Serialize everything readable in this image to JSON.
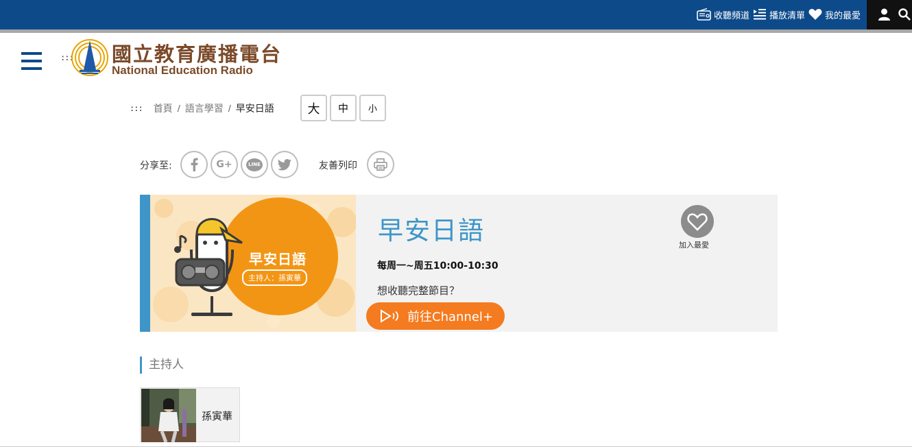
{
  "topbar": {
    "links": [
      {
        "icon": "radio-icon",
        "label": "收聽頻道"
      },
      {
        "icon": "playlist-icon",
        "label": "播放清單"
      },
      {
        "icon": "heart-icon",
        "label": "我的最愛"
      }
    ],
    "user_icon": "user-icon",
    "search_icon": "search-icon"
  },
  "header": {
    "menu_icon": "hamburger-menu-icon",
    "logo_dots": ":::",
    "logo_cn": "國立教育廣播電台",
    "logo_en": "National Education Radio"
  },
  "breadcrumb": {
    "dots": ":::",
    "items": [
      "首頁",
      "語言學習",
      "早安日語"
    ],
    "separator": "/"
  },
  "font_size": {
    "buttons": [
      "大",
      "中",
      "小"
    ]
  },
  "share": {
    "label": "分享至:",
    "buttons": [
      "facebook-icon",
      "google-plus-icon",
      "line-icon",
      "twitter-icon"
    ],
    "gplus_text": "G+",
    "line_text": "LINE",
    "print_label": "友善列印",
    "print_icon": "printer-icon"
  },
  "program": {
    "banner_title": "早安日語",
    "banner_host": "主持人：孫寅華",
    "title": "早安日語",
    "schedule": "每周一~周五10:00-10:30",
    "question": "想收聽完整節目？",
    "channel_button": "前往Channel+",
    "favorite_label": "加入最愛"
  },
  "host_section": {
    "heading": "主持人",
    "hosts": [
      {
        "name": "孫寅華"
      }
    ]
  },
  "colors": {
    "topbar": "#0d4a8a",
    "accent_blue": "#3d95c8",
    "channel_orange": "#f47b20",
    "logo_brown": "#7b4a2a"
  }
}
